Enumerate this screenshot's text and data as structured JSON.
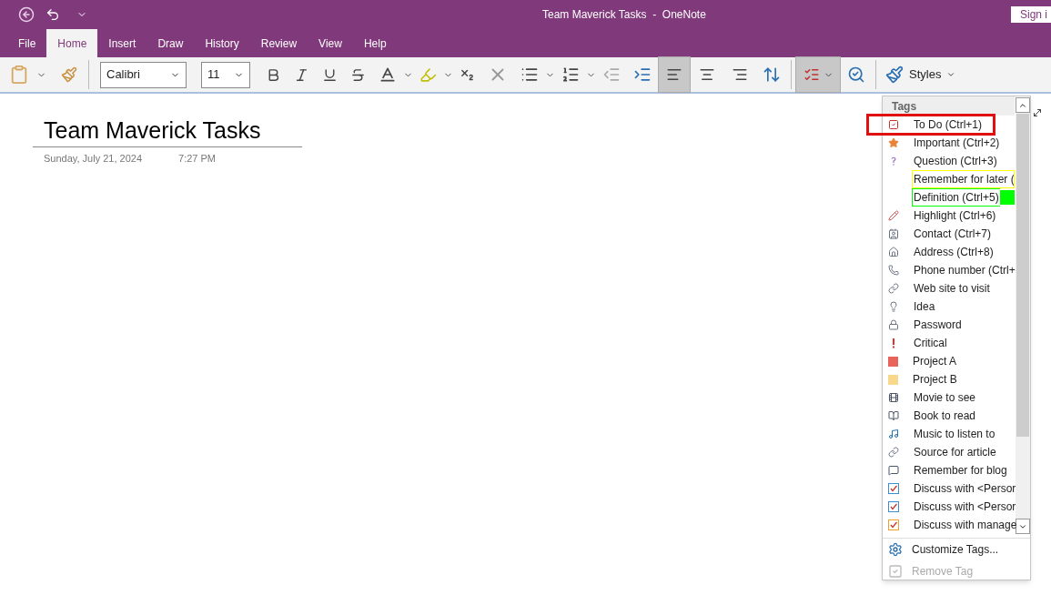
{
  "window": {
    "title": "Team Maverick Tasks  -  OneNote",
    "sign_in": "Sign i"
  },
  "tabs": [
    {
      "label": "File",
      "selected": false
    },
    {
      "label": "Home",
      "selected": true
    },
    {
      "label": "Insert",
      "selected": false
    },
    {
      "label": "Draw",
      "selected": false
    },
    {
      "label": "History",
      "selected": false
    },
    {
      "label": "Review",
      "selected": false
    },
    {
      "label": "View",
      "selected": false
    },
    {
      "label": "Help",
      "selected": false
    }
  ],
  "ribbon": {
    "font": "Calibri",
    "size": "11",
    "align_buttons": [
      {
        "kind": "left",
        "selected": true
      },
      {
        "kind": "center",
        "selected": false
      },
      {
        "kind": "right",
        "selected": false
      }
    ],
    "tags_button": {
      "selected": true
    },
    "styles": "Styles"
  },
  "page": {
    "title": "Team Maverick Tasks",
    "date": "Sunday, July 21, 2024",
    "time": "7:27 PM"
  },
  "tags_menu": {
    "header": "Tags",
    "items": [
      {
        "kind": "todo",
        "label": "To Do (Ctrl+1)",
        "marked": true
      },
      {
        "kind": "star",
        "label": "Important (Ctrl+2)",
        "marked": false
      },
      {
        "kind": "question",
        "label": "Question (Ctrl+3)",
        "marked": false
      },
      {
        "kind": "yellow-frame",
        "label": "Remember for later (",
        "marked": false
      },
      {
        "kind": "green-frame",
        "label": "Definition (Ctrl+5)",
        "marked": false
      },
      {
        "kind": "pencil",
        "label": "Highlight (Ctrl+6)",
        "marked": false
      },
      {
        "kind": "contact",
        "label": "Contact (Ctrl+7)",
        "marked": false
      },
      {
        "kind": "house",
        "label": "Address (Ctrl+8)",
        "marked": false
      },
      {
        "kind": "phone",
        "label": "Phone number (Ctrl+",
        "marked": false
      },
      {
        "kind": "link",
        "label": "Web site to visit",
        "marked": false
      },
      {
        "kind": "bulb",
        "label": "Idea",
        "marked": false
      },
      {
        "kind": "lock",
        "label": "Password",
        "marked": false
      },
      {
        "kind": "exclaim",
        "label": "Critical",
        "marked": false
      },
      {
        "kind": "square",
        "label": "Project A",
        "color": "#e8645a",
        "marked": false
      },
      {
        "kind": "square",
        "label": "Project B",
        "color": "#f8d98c",
        "marked": false
      },
      {
        "kind": "film",
        "label": "Movie to see",
        "marked": false
      },
      {
        "kind": "book",
        "label": "Book to read",
        "marked": false
      },
      {
        "kind": "music",
        "label": "Music to listen to",
        "marked": false
      },
      {
        "kind": "link",
        "label": "Source for article",
        "marked": false
      },
      {
        "kind": "speech",
        "label": "Remember for blog",
        "marked": false
      },
      {
        "kind": "discuss",
        "label": "Discuss with <Persor",
        "color": "#3b8fd1",
        "marked": false
      },
      {
        "kind": "discuss",
        "label": "Discuss with <Persor",
        "color": "#3b8fd1",
        "marked": false
      },
      {
        "kind": "discuss",
        "label": "Discuss with manage",
        "color": "#f0a030",
        "marked": false
      }
    ],
    "actions": [
      {
        "label": "Customize Tags...",
        "disabled": false
      },
      {
        "label": "Remove Tag",
        "disabled": true
      }
    ]
  }
}
